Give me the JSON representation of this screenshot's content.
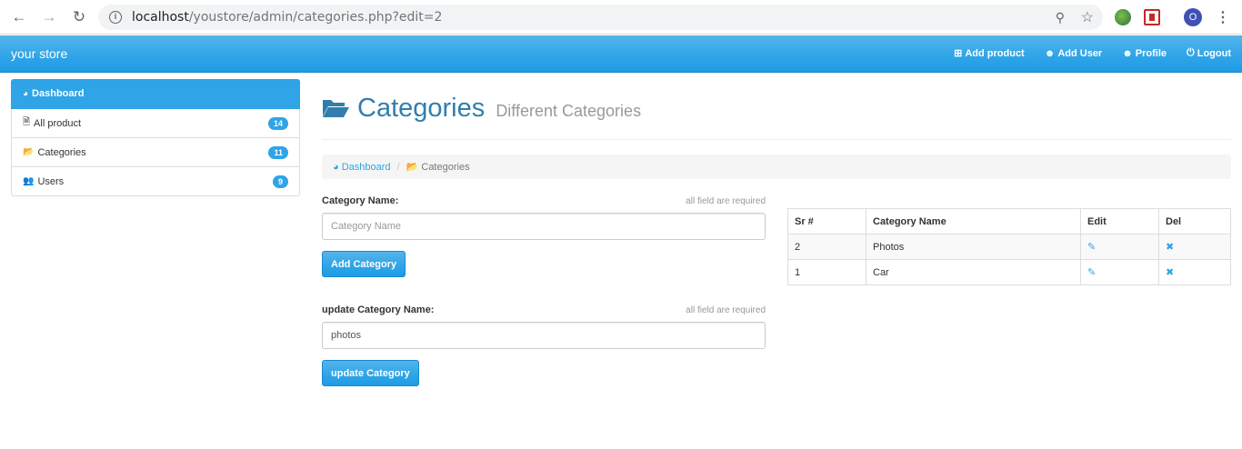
{
  "browser": {
    "url_host": "localhost",
    "url_path": "/youstore/admin/categories.php?edit=2",
    "profile_initial": "O"
  },
  "navbar": {
    "brand": "your store",
    "links": [
      {
        "label": "Add product",
        "icon": "plus-square-icon"
      },
      {
        "label": "Add User",
        "icon": "user-plus-icon"
      },
      {
        "label": "Profile",
        "icon": "user-icon"
      },
      {
        "label": "Logout",
        "icon": "power-icon"
      }
    ]
  },
  "sidebar": {
    "items": [
      {
        "label": "Dashboard",
        "icon": "dashboard-icon",
        "active": true
      },
      {
        "label": "All product",
        "icon": "file-icon",
        "badge": "14"
      },
      {
        "label": "Categories",
        "icon": "folder-open-icon",
        "badge": "11"
      },
      {
        "label": "Users",
        "icon": "users-icon",
        "badge": "9"
      }
    ]
  },
  "header": {
    "title": "Categories",
    "subtitle": "Different Categories"
  },
  "breadcrumb": {
    "home": "Dashboard",
    "current": "Categories"
  },
  "add_form": {
    "label": "Category Name:",
    "hint": "all field are required",
    "placeholder": "Category Name",
    "button": "Add Category"
  },
  "update_form": {
    "label": "update Category Name:",
    "hint": "all field are required",
    "value": "photos",
    "button": "update Category"
  },
  "table": {
    "headers": [
      "Sr #",
      "Category Name",
      "Edit",
      "Del"
    ],
    "rows": [
      {
        "sr": "2",
        "name": "Photos"
      },
      {
        "sr": "1",
        "name": "Car"
      }
    ]
  },
  "colors": {
    "primary": "#2fa4e7",
    "title": "#317eac"
  }
}
